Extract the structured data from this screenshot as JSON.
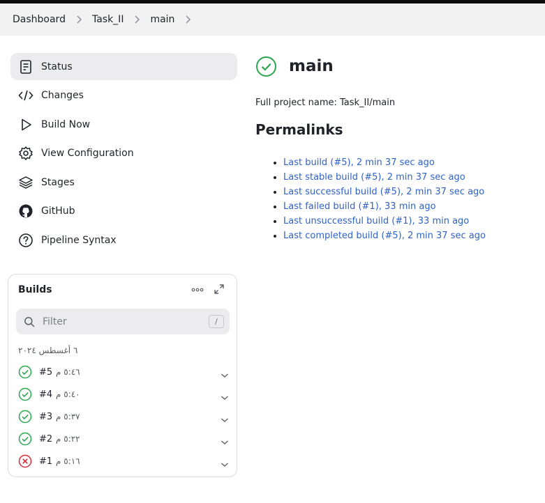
{
  "breadcrumb": [
    "Dashboard",
    "Task_II",
    "main"
  ],
  "sidebar": {
    "items": [
      {
        "label": "Status",
        "icon": "document-icon",
        "active": true
      },
      {
        "label": "Changes",
        "icon": "code-icon"
      },
      {
        "label": "Build Now",
        "icon": "play-icon"
      },
      {
        "label": "View Configuration",
        "icon": "gear-icon"
      },
      {
        "label": "Stages",
        "icon": "layers-icon"
      },
      {
        "label": "GitHub",
        "icon": "github-icon"
      },
      {
        "label": "Pipeline Syntax",
        "icon": "help-icon"
      }
    ]
  },
  "builds": {
    "title": "Builds",
    "filter_placeholder": "Filter",
    "shortcut": "/",
    "date": "٦ أغسطس ٢٠٢٤",
    "rows": [
      {
        "number": "#5",
        "time": "٥:٤٦ م",
        "status": "success"
      },
      {
        "number": "#4",
        "time": "٥:٤٠ م",
        "status": "success"
      },
      {
        "number": "#3",
        "time": "٥:٣٧ م",
        "status": "success"
      },
      {
        "number": "#2",
        "time": "٥:٢٢ م",
        "status": "success"
      },
      {
        "number": "#1",
        "time": "٥:١٦ م",
        "status": "failed"
      }
    ]
  },
  "main": {
    "title": "main",
    "full_project_name": "Full project name: Task_II/main",
    "permalinks_heading": "Permalinks",
    "permalinks": [
      "Last build (#5), 2 min 37 sec ago",
      "Last stable build (#5), 2 min 37 sec ago",
      "Last successful build (#5), 2 min 37 sec ago",
      "Last failed build (#1), 33 min ago",
      "Last unsuccessful build (#1), 33 min ago",
      "Last completed build (#5), 2 min 37 sec ago"
    ]
  },
  "colors": {
    "success": "#2ea44f",
    "failed": "#d62b3b",
    "link": "#2f62c7"
  }
}
